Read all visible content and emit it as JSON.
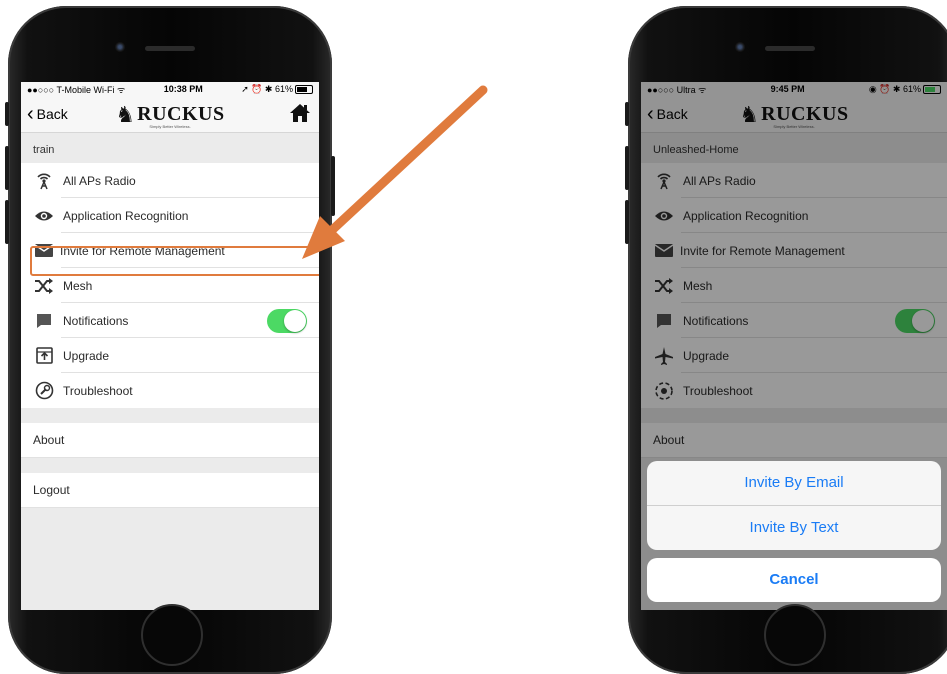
{
  "left_phone": {
    "status": {
      "carrier": "●●○○○ T-Mobile Wi-Fi ᯤ",
      "time": "10:38 PM",
      "right": "➚ ⏰ ✱ 61%"
    },
    "nav": {
      "back_label": "Back",
      "logo_text": "RUCKUS",
      "logo_tagline": "Simply Better Wireless."
    },
    "section_title": "train",
    "menu": [
      {
        "label": "All APs Radio",
        "icon": "antenna-icon"
      },
      {
        "label": "Application Recognition",
        "icon": "eye-icon"
      },
      {
        "label": "Invite for Remote Management",
        "icon": "envelope-icon"
      },
      {
        "label": "Mesh",
        "icon": "shuffle-icon"
      },
      {
        "label": "Notifications",
        "icon": "chat-bubble-icon",
        "toggle_on": true
      },
      {
        "label": "Upgrade",
        "icon": "upgrade-icon"
      },
      {
        "label": "Troubleshoot",
        "icon": "troubleshoot-icon"
      }
    ],
    "about_label": "About",
    "logout_label": "Logout"
  },
  "right_phone": {
    "status": {
      "carrier": "●●○○○ Ultra ᯤ",
      "time": "9:45 PM",
      "right": "◉ ⏰ ✱ 61%"
    },
    "nav": {
      "back_label": "Back",
      "logo_text": "RUCKUS",
      "logo_tagline": "Simply Better Wireless."
    },
    "section_title": "Unleashed-Home",
    "menu": [
      {
        "label": "All APs Radio",
        "icon": "antenna-icon"
      },
      {
        "label": "Application Recognition",
        "icon": "eye-icon"
      },
      {
        "label": "Invite for Remote Management",
        "icon": "envelope-icon"
      },
      {
        "label": "Mesh",
        "icon": "shuffle-icon"
      },
      {
        "label": "Notifications",
        "icon": "chat-bubble-icon",
        "toggle_on": true
      },
      {
        "label": "Upgrade",
        "icon": "airplane-icon"
      },
      {
        "label": "Troubleshoot",
        "icon": "target-icon"
      }
    ],
    "about_label": "About",
    "action_sheet": {
      "email_label": "Invite By Email",
      "text_label": "Invite By Text",
      "cancel_label": "Cancel"
    }
  },
  "colors": {
    "accent_arrow": "#e07b3d",
    "ios_blue": "#1a7cf5",
    "toggle_green": "#4cd964"
  }
}
